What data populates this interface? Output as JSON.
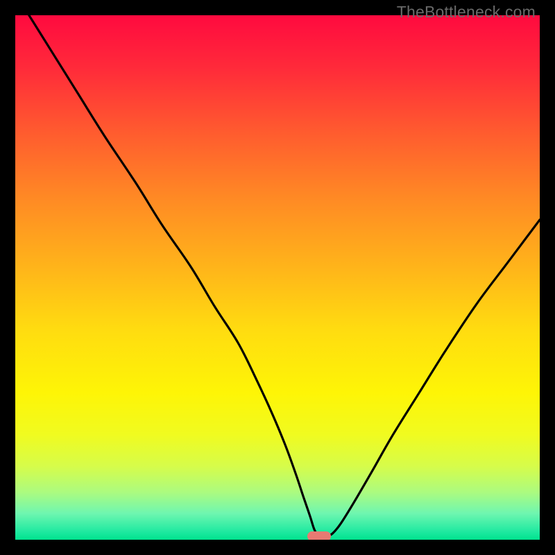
{
  "watermark": "TheBottleneck.com",
  "gradient": {
    "stops": [
      {
        "offset": 0.0,
        "color": "#ff0a3f"
      },
      {
        "offset": 0.1,
        "color": "#ff2a3a"
      },
      {
        "offset": 0.22,
        "color": "#ff5a2f"
      },
      {
        "offset": 0.35,
        "color": "#ff8a24"
      },
      {
        "offset": 0.48,
        "color": "#ffb41a"
      },
      {
        "offset": 0.6,
        "color": "#ffdc10"
      },
      {
        "offset": 0.72,
        "color": "#fef506"
      },
      {
        "offset": 0.8,
        "color": "#f0fb20"
      },
      {
        "offset": 0.86,
        "color": "#d6fc4a"
      },
      {
        "offset": 0.91,
        "color": "#abfb80"
      },
      {
        "offset": 0.95,
        "color": "#6ef6b0"
      },
      {
        "offset": 0.985,
        "color": "#1ee9a0"
      },
      {
        "offset": 1.0,
        "color": "#00e38e"
      }
    ]
  },
  "chart_data": {
    "type": "line",
    "title": "",
    "xlabel": "",
    "ylabel": "",
    "xlim": [
      0,
      100
    ],
    "ylim": [
      0,
      100
    ],
    "grid": false,
    "series": [
      {
        "name": "bottleneck-curve",
        "x": [
          2,
          7,
          12,
          17,
          23,
          28,
          33.5,
          38,
          42.5,
          46,
          49,
          51.5,
          53.5,
          55,
          56.2,
          57,
          57.7,
          58.5,
          59.5,
          60.5,
          62,
          64.5,
          68,
          72,
          77,
          82,
          88,
          94,
          100
        ],
        "values": [
          101,
          93,
          85,
          77,
          68,
          60,
          52,
          44.5,
          37.5,
          30.5,
          24,
          18,
          12.5,
          8,
          4.5,
          2,
          0.9,
          0.6,
          0.7,
          1.2,
          3,
          7,
          13,
          20,
          28,
          36,
          45,
          53,
          61
        ]
      }
    ],
    "marker": {
      "x": 58,
      "y": 0.6
    },
    "annotations": [
      {
        "text": "TheBottleneck.com",
        "role": "watermark"
      }
    ]
  }
}
